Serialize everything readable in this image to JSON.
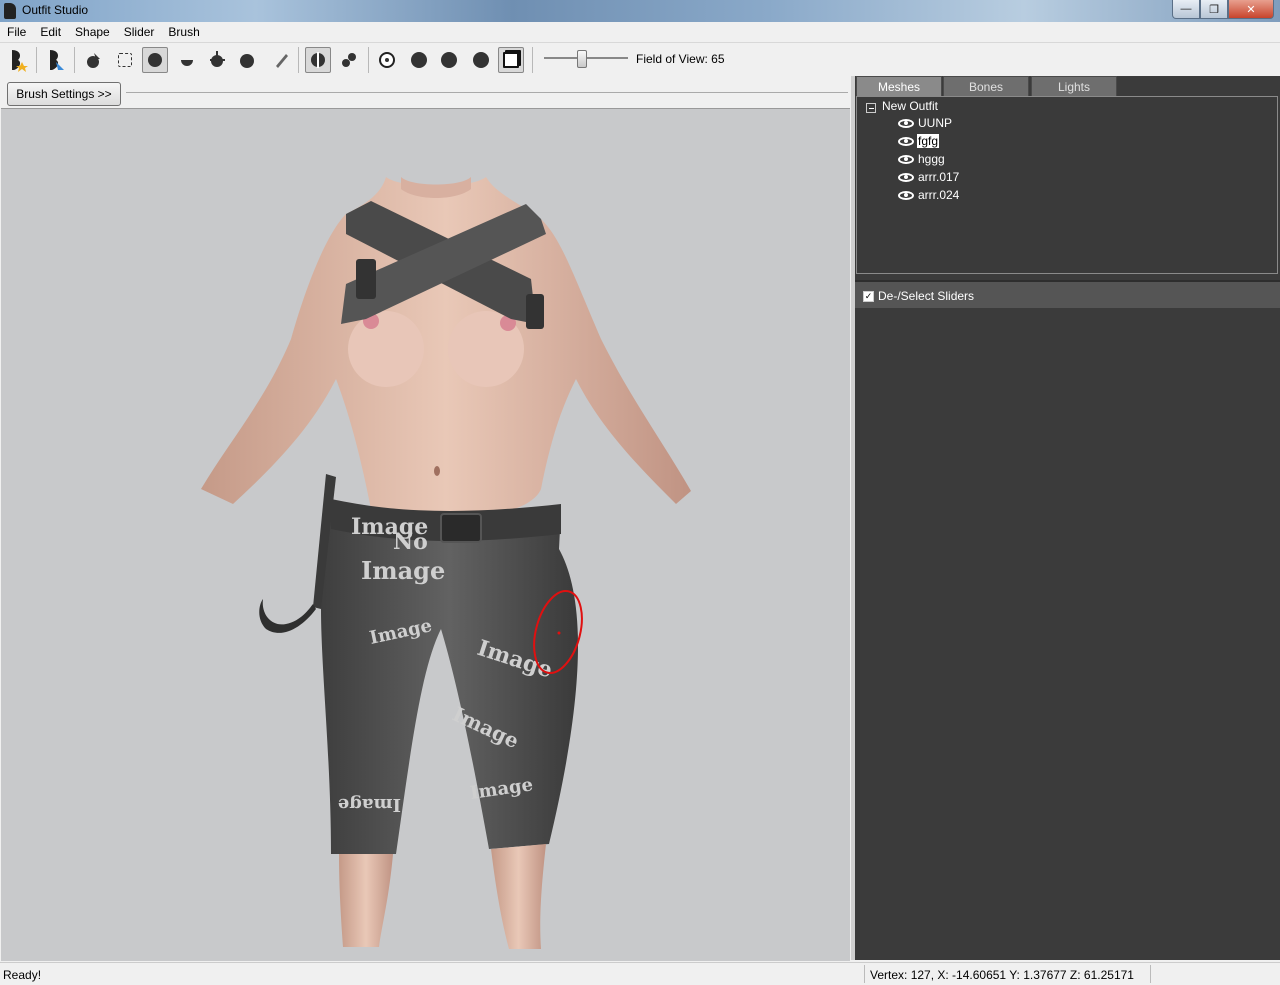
{
  "window": {
    "title": "Outfit Studio"
  },
  "menu": [
    "File",
    "Edit",
    "Shape",
    "Slider",
    "Brush"
  ],
  "toolbar": {
    "fov_label": "Field of View: 65"
  },
  "brush_settings_label": "Brush Settings >>",
  "tabs": [
    {
      "label": "Meshes",
      "active": true
    },
    {
      "label": "Bones",
      "active": false
    },
    {
      "label": "Lights",
      "active": false
    }
  ],
  "tree": {
    "root": "New Outfit",
    "meshes": [
      {
        "label": "UUNP",
        "selected": false
      },
      {
        "label": "fgfg",
        "selected": true
      },
      {
        "label": "hggg",
        "selected": false
      },
      {
        "label": "arrr.017",
        "selected": false
      },
      {
        "label": "arrr.024",
        "selected": false
      }
    ]
  },
  "sliders": {
    "toggle_label": "De-/Select Sliders",
    "checked": true
  },
  "viewport": {
    "texture_text": [
      "No",
      "Image"
    ]
  },
  "status": {
    "left": "Ready!",
    "right": "Vertex: 127, X: -14.60651 Y: 1.37677 Z: 61.25171"
  },
  "colors": {
    "panel_dark": "#3b3b3b",
    "viewport_bg": "#c8c9cb",
    "brush_ring": "#e01010"
  }
}
